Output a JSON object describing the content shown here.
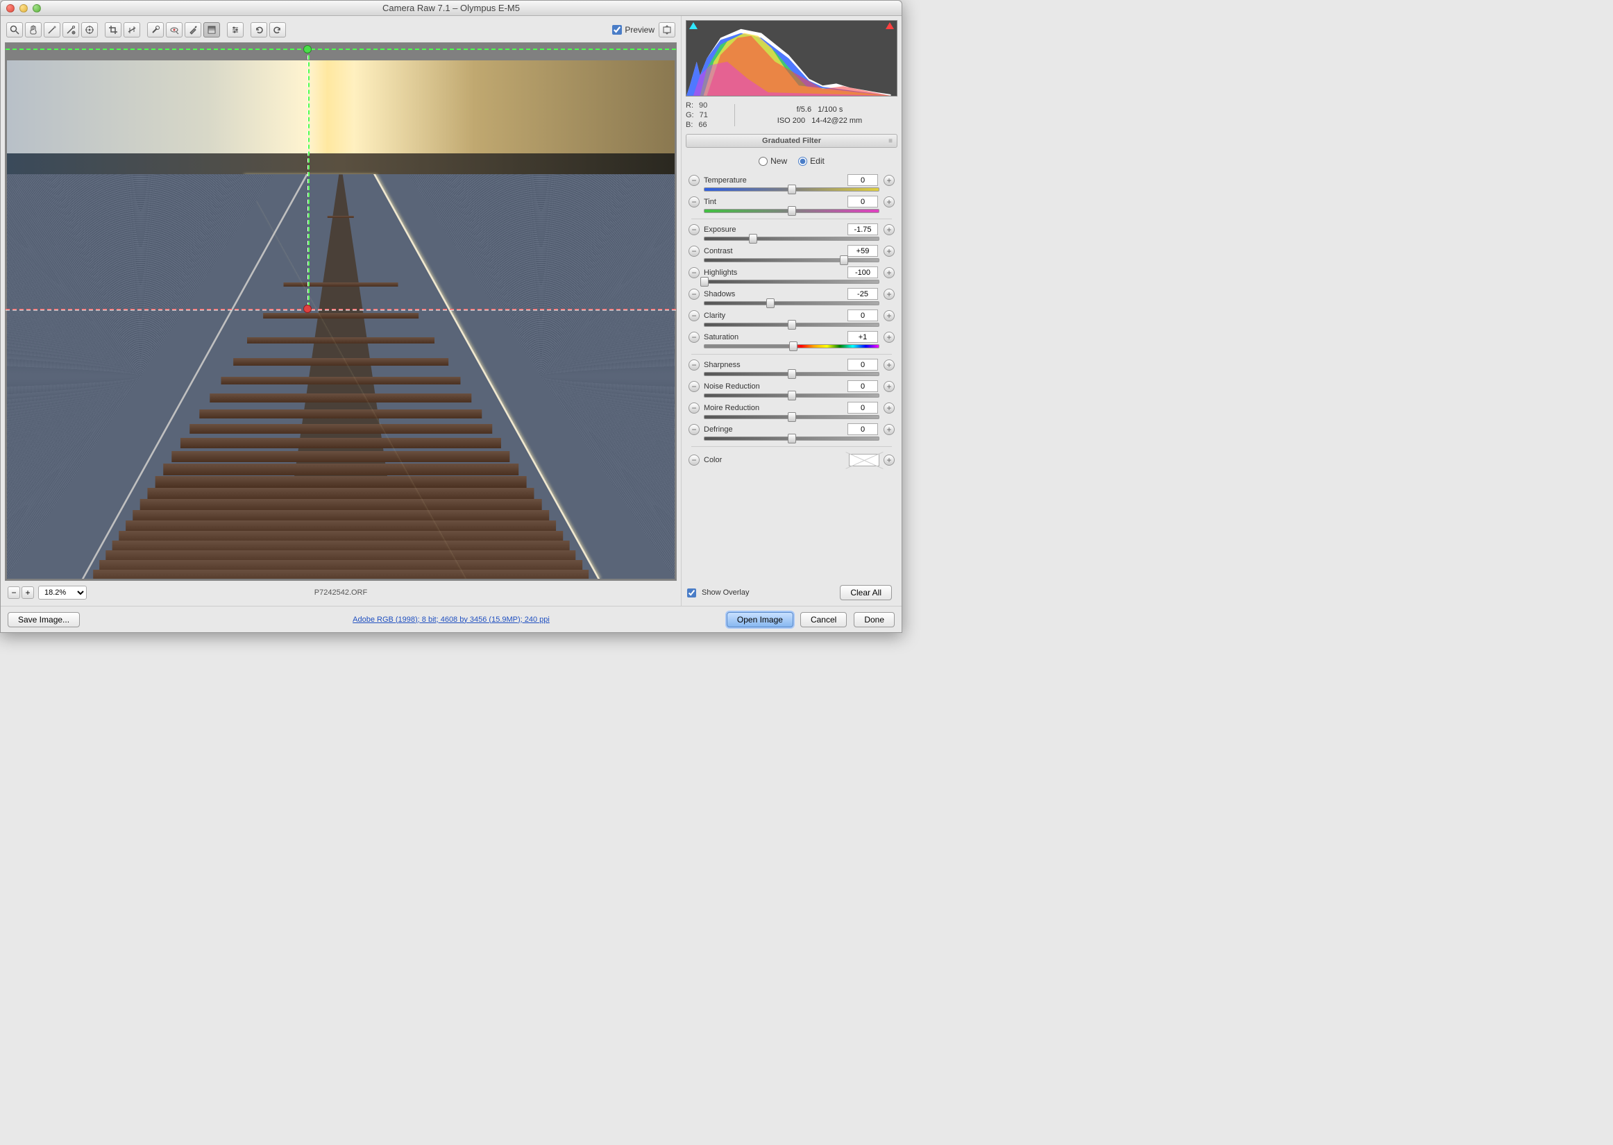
{
  "window": {
    "title": "Camera Raw 7.1  –  Olympus E-M5"
  },
  "toolbar": {
    "preview_label": "Preview",
    "preview_checked": true
  },
  "image": {
    "filename": "P7242542.ORF",
    "zoom": "18.2%"
  },
  "info": {
    "rgb": {
      "r_label": "R:",
      "r": "90",
      "g_label": "G:",
      "g": "71",
      "b_label": "B:",
      "b": "66"
    },
    "aperture": "f/5.6",
    "shutter": "1/100 s",
    "iso": "ISO 200",
    "lens": "14-42@22 mm"
  },
  "panel": {
    "title": "Graduated Filter",
    "mode_new": "New",
    "mode_edit": "Edit",
    "mode": "edit",
    "sliders": {
      "temperature": {
        "label": "Temperature",
        "value": "0",
        "pos": 50
      },
      "tint": {
        "label": "Tint",
        "value": "0",
        "pos": 50
      },
      "exposure": {
        "label": "Exposure",
        "value": "-1.75",
        "pos": 28
      },
      "contrast": {
        "label": "Contrast",
        "value": "+59",
        "pos": 80
      },
      "highlights": {
        "label": "Highlights",
        "value": "-100",
        "pos": 0
      },
      "shadows": {
        "label": "Shadows",
        "value": "-25",
        "pos": 38
      },
      "clarity": {
        "label": "Clarity",
        "value": "0",
        "pos": 50
      },
      "saturation": {
        "label": "Saturation",
        "value": "+1",
        "pos": 51
      },
      "sharpness": {
        "label": "Sharpness",
        "value": "0",
        "pos": 50
      },
      "noise": {
        "label": "Noise Reduction",
        "value": "0",
        "pos": 50
      },
      "moire": {
        "label": "Moire Reduction",
        "value": "0",
        "pos": 50
      },
      "defringe": {
        "label": "Defringe",
        "value": "0",
        "pos": 50
      }
    },
    "color_label": "Color",
    "overlay_label": "Show Overlay",
    "overlay_checked": true,
    "clear_all": "Clear All"
  },
  "footer": {
    "save_image": "Save Image...",
    "link": "Adobe RGB (1998); 8 bit; 4608 by 3456 (15.9MP); 240 ppi",
    "open_image": "Open Image",
    "cancel": "Cancel",
    "done": "Done"
  }
}
